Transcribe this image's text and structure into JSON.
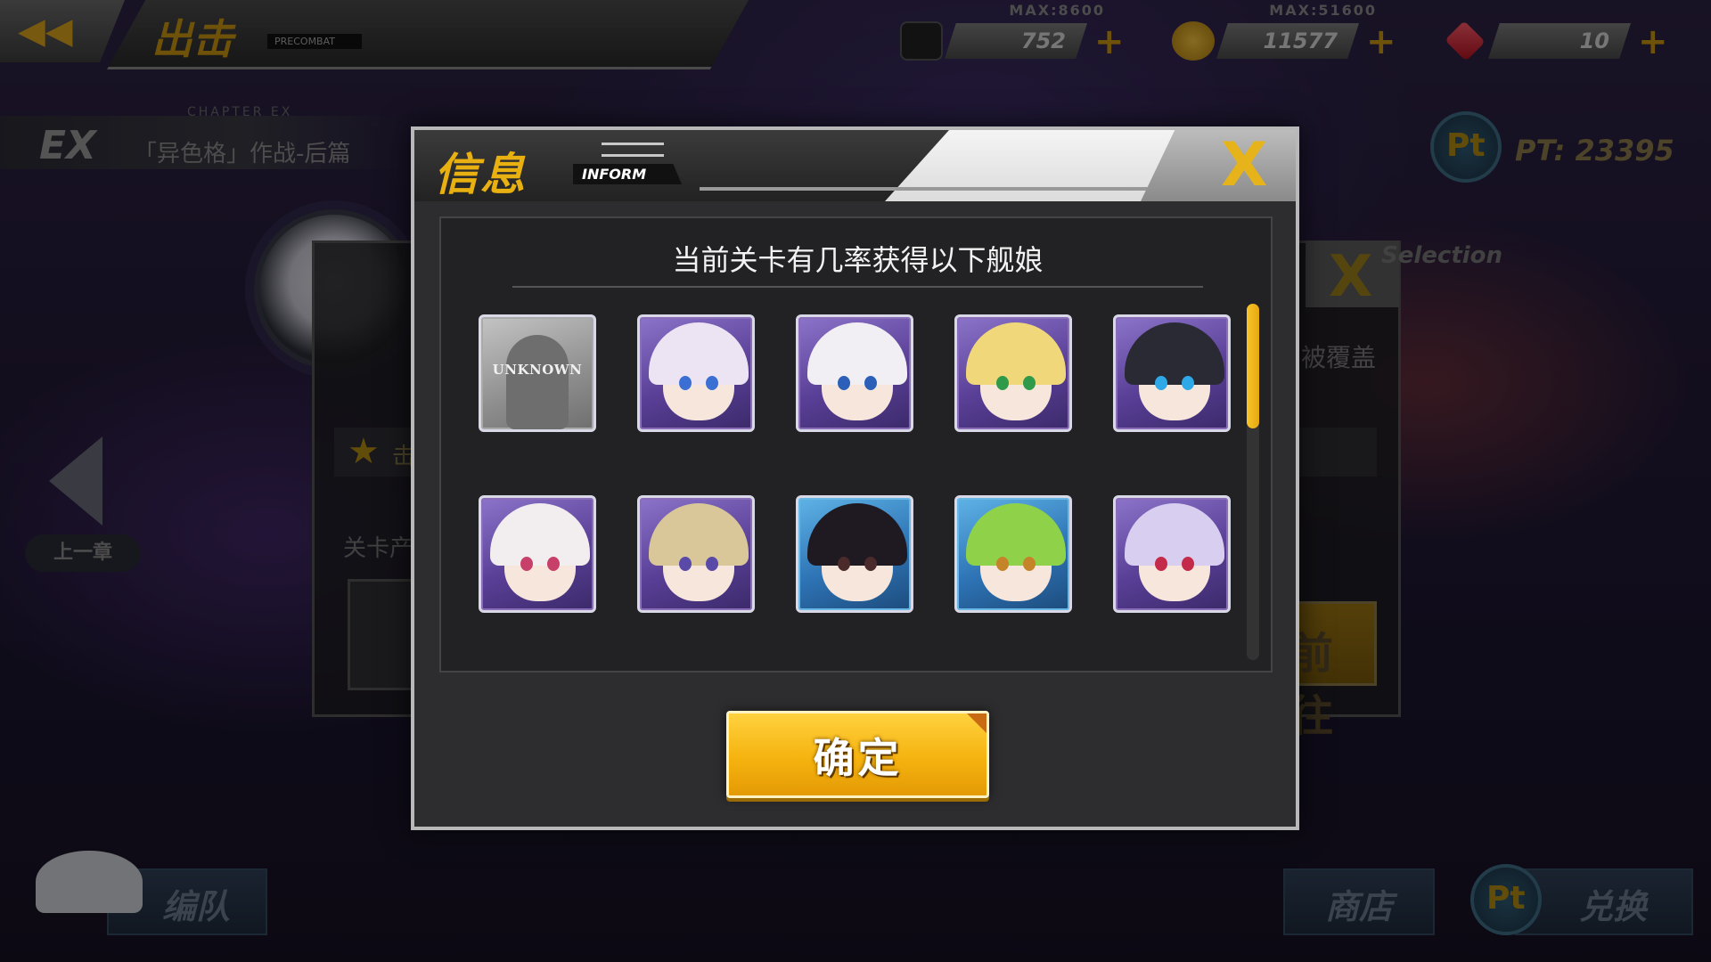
{
  "topbar": {
    "title": "出击",
    "subtitle": "PRECOMBAT",
    "resources": [
      {
        "name": "oil",
        "max": "MAX:8600",
        "value": "752",
        "icon": "oil-barrel-icon",
        "color": "#222222"
      },
      {
        "name": "gold",
        "max": "MAX:51600",
        "value": "11577",
        "icon": "gold-coin-icon",
        "color": "#d9a21c"
      },
      {
        "name": "gem",
        "max": "",
        "value": "10",
        "icon": "red-gem-icon",
        "color": "#e02a3a"
      }
    ]
  },
  "chapter": {
    "code": "EX",
    "small": "CHAPTER EX",
    "name": "「异色格」作战-后篇"
  },
  "pt_label": "PT: 23395",
  "prev_chapter": "上一章",
  "background_dialog": {
    "label": "Selection",
    "cover_text": "被覆盖",
    "star_text": "击破",
    "drop_label": "关卡产出",
    "go_label": "前往"
  },
  "bottom": {
    "left_label": "编队",
    "middle_label": "商店",
    "right_label": "兑换"
  },
  "modal": {
    "title": "信息",
    "subtitle": "INFORM",
    "heading": "当前关卡有几率获得以下舰娘",
    "unknown_label": "UNKNOWN",
    "confirm_label": "确定",
    "cards": [
      {
        "rarity": "gray",
        "hair": "#6e6e6e",
        "eye": "#6e6e6e",
        "unknown": true
      },
      {
        "rarity": "purple",
        "hair": "#ece4f2",
        "eye": "#3b6fd4"
      },
      {
        "rarity": "purple",
        "hair": "#f1eef4",
        "eye": "#2c5fb8"
      },
      {
        "rarity": "purple",
        "hair": "#f0d77a",
        "eye": "#2f9b4a"
      },
      {
        "rarity": "purple",
        "hair": "#2a2a35",
        "eye": "#2ea8e6"
      },
      {
        "rarity": "purple",
        "hair": "#f2eef0",
        "eye": "#c7406a"
      },
      {
        "rarity": "purple",
        "hair": "#d9c79a",
        "eye": "#5a4aa8"
      },
      {
        "rarity": "blue",
        "hair": "#1f1a22",
        "eye": "#4a2a2a"
      },
      {
        "rarity": "blue",
        "hair": "#8fd24a",
        "eye": "#c5842a"
      },
      {
        "rarity": "purple",
        "hair": "#d8cff0",
        "eye": "#c42a4a"
      }
    ],
    "scroll_fraction": 0.35
  }
}
